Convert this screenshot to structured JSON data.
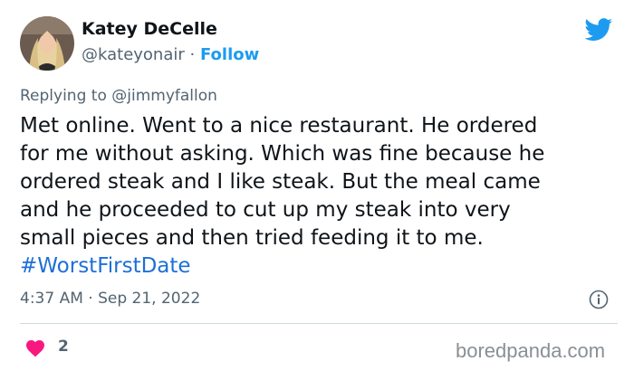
{
  "author": {
    "name": "Katey DeCelle",
    "handle": "@kateyonair",
    "separator": "·",
    "follow_label": "Follow",
    "avatar_icon": "profile-photo"
  },
  "platform_icon": "twitter-bird-icon",
  "reply": {
    "prefix": "Replying to",
    "to": "@jimmyfallon"
  },
  "tweet": {
    "text": "Met online. Went to a nice restaurant. He ordered\nfor me without asking. Which was fine because he\nordered steak and I like steak. But the meal came\nand he proceeded to cut up my steak into very\nsmall pieces and then tried feeding it to me.",
    "hashtag": "#WorstFirstDate"
  },
  "meta": {
    "time": "4:37 AM",
    "separator": "·",
    "date": "Sep 21, 2022"
  },
  "engagement": {
    "likes": "2",
    "heart_color": "#f91880"
  },
  "watermark": "boredpanda.com",
  "colors": {
    "accent": "#1d9bf0",
    "hashtag": "#1d6fd8",
    "muted": "#536471"
  }
}
